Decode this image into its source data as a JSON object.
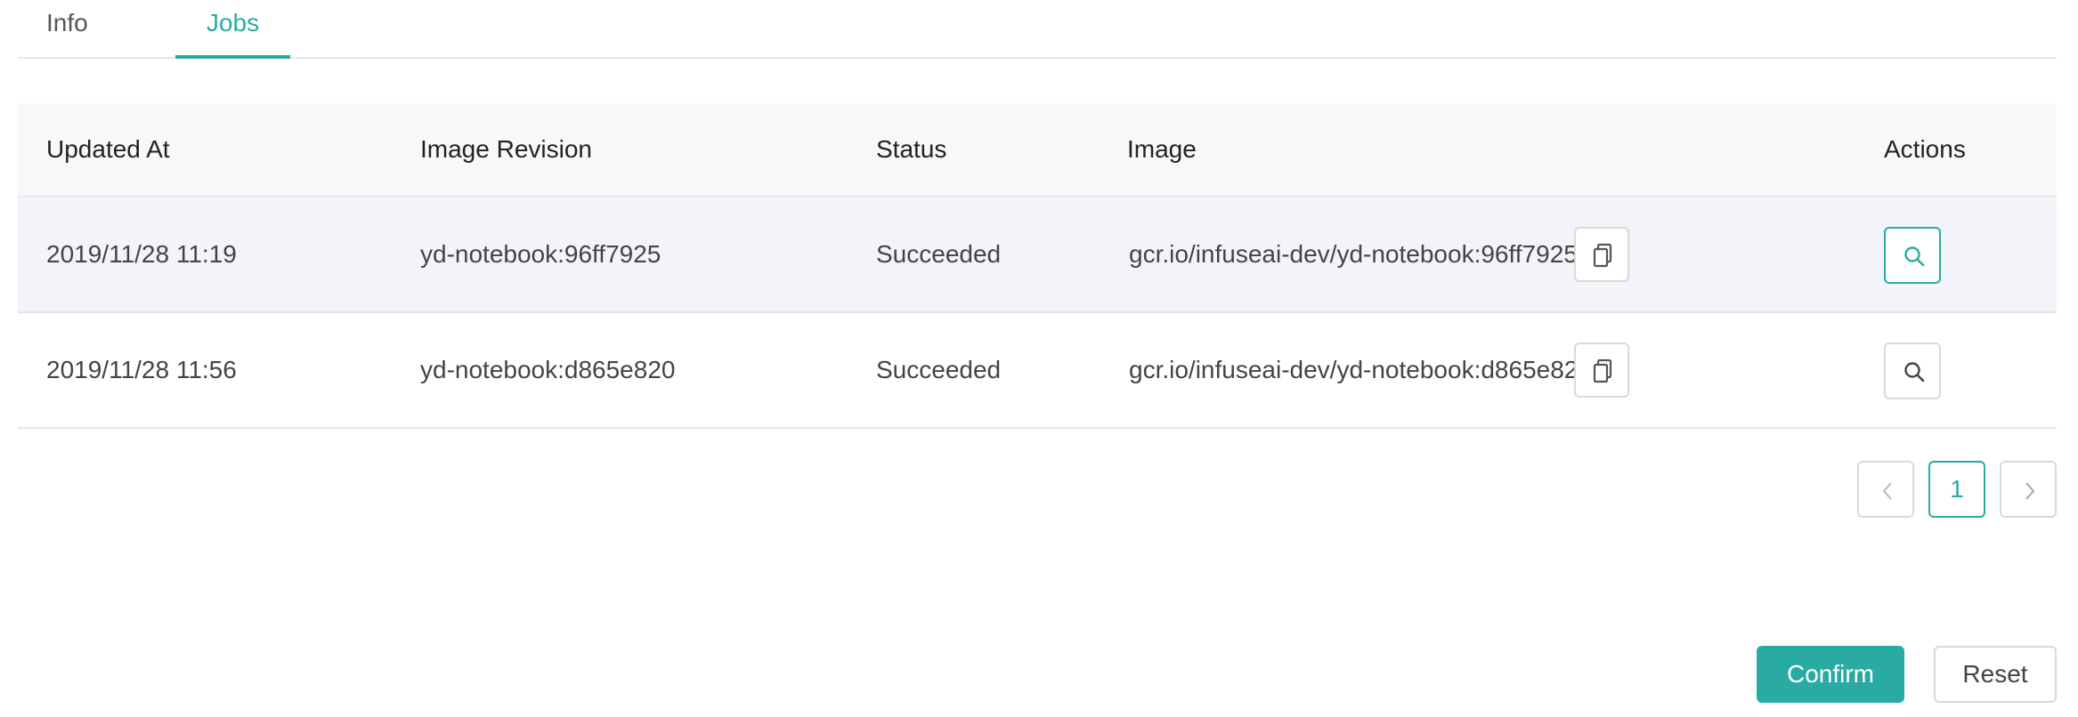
{
  "tabs": {
    "info": "Info",
    "jobs": "Jobs",
    "active": "Jobs"
  },
  "table": {
    "headers": {
      "updated_at": "Updated At",
      "image_revision": "Image Revision",
      "status": "Status",
      "image": "Image",
      "actions": "Actions"
    },
    "rows": [
      {
        "updated_at": "2019/11/28 11:19",
        "image_revision": "yd-notebook:96ff7925",
        "status": "Succeeded",
        "image": "gcr.io/infuseai-dev/yd-notebook:96ff7925",
        "copy_icon": "copy-icon",
        "action_icon": "search-icon",
        "highlighted": true
      },
      {
        "updated_at": "2019/11/28 11:56",
        "image_revision": "yd-notebook:d865e820",
        "status": "Succeeded",
        "image": "gcr.io/infuseai-dev/yd-notebook:d865e820",
        "copy_icon": "copy-icon",
        "action_icon": "search-icon",
        "highlighted": false
      }
    ]
  },
  "pagination": {
    "prev_icon": "chevron-left-icon",
    "current_page": "1",
    "next_icon": "chevron-right-icon"
  },
  "footer": {
    "confirm_label": "Confirm",
    "reset_label": "Reset"
  },
  "colors": {
    "accent": "#29aba3",
    "row_highlight": "#f2f4f9",
    "header_bg": "#f8f8f8",
    "border": "#d9d9d9"
  }
}
